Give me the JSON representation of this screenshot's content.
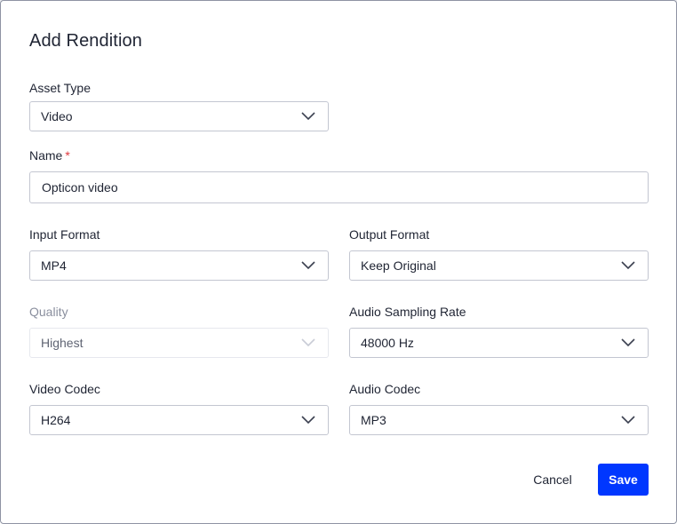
{
  "dialog": {
    "title": "Add Rendition"
  },
  "fields": {
    "asset_type": {
      "label": "Asset Type",
      "value": "Video"
    },
    "name": {
      "label": "Name",
      "required_mark": "*",
      "value": "Opticon video"
    },
    "input_format": {
      "label": "Input Format",
      "value": "MP4"
    },
    "output_format": {
      "label": "Output Format",
      "value": "Keep Original"
    },
    "quality": {
      "label": "Quality",
      "value": "Highest",
      "disabled": true
    },
    "audio_sampling_rate": {
      "label": "Audio Sampling Rate",
      "value": "48000 Hz"
    },
    "video_codec": {
      "label": "Video Codec",
      "value": "H264"
    },
    "audio_codec": {
      "label": "Audio Codec",
      "value": "MP3"
    }
  },
  "actions": {
    "cancel_label": "Cancel",
    "save_label": "Save"
  },
  "colors": {
    "primary": "#0037ff",
    "required": "#e0393e",
    "border": "#c3c6d1",
    "disabled_text": "#8a8f9e"
  },
  "icons": {
    "dropdown": "chevron-down-icon"
  }
}
